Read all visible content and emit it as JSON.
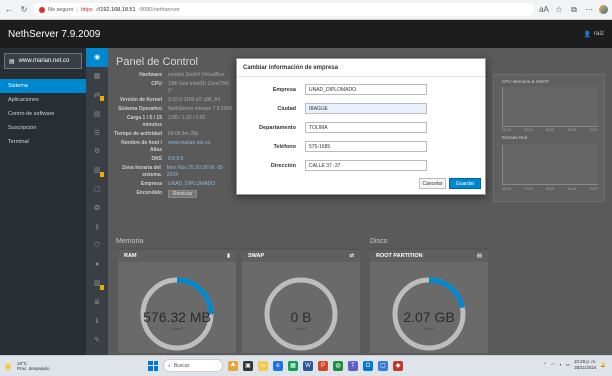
{
  "browser": {
    "insecure_label": "No seguro",
    "url_https": "https",
    "url_host": "://192.168.18.51",
    "url_path": ":9090/nethserver",
    "zoom_badge": "aA"
  },
  "app": {
    "brand": "NethServer 7.9.2009",
    "user_label": "raíz"
  },
  "sidebar": {
    "host": "www.marian.net.co",
    "items": [
      {
        "label": "Sistema"
      },
      {
        "label": "Aplicaciones"
      },
      {
        "label": "Centro de software"
      },
      {
        "label": "Suscripción"
      },
      {
        "label": "Terminal"
      }
    ]
  },
  "panel": {
    "title": "Panel de Control",
    "rows": [
      {
        "label": "Hardware",
        "value": "innotek GmbH VirtualBox"
      },
      {
        "label": "CPU",
        "value": "13th Gen Intel(R) Core(TM) i7"
      },
      {
        "label": "Versión de Kernel",
        "value": "3.10.0-1160.el7.x86_64"
      },
      {
        "label": "Sistema Operativo",
        "value": "NethServer release 7.9.2009"
      },
      {
        "label": "Carga 1 / 5 / 15 minutos",
        "value": "2.80 / 1.62 / 0.82"
      },
      {
        "label": "Tiempo de actividad",
        "value": "0d 0h 5m 28s"
      },
      {
        "label": "Nombre de host / Alias",
        "value": "www.marian.net.co"
      },
      {
        "label": "DNS",
        "value": "8.8.8.8"
      },
      {
        "label": "Zona horaria del sistema",
        "value": "Mon Nov 25 20:28:06 -05 2024"
      },
      {
        "label": "Empresa",
        "value": "UNAD_DIPLOMADO"
      },
      {
        "label": "Encendido",
        "value": "Reiniciar"
      }
    ],
    "memory_chart_legend": "CPU  Memoria & SWAP",
    "red_chart_legend": "Entrada  Red",
    "chart_ticks": [
      "20:23",
      "20:24",
      "20:25",
      "20:26",
      "20:27"
    ]
  },
  "sections": {
    "memoria": "Memoria",
    "disco": "Disco"
  },
  "cards": [
    {
      "title": "RAM",
      "value": "576.32 MB",
      "sub": "Used",
      "fraction": 0.25
    },
    {
      "title": "SWAP",
      "value": "0 B",
      "sub": "Used",
      "fraction": 0.0
    },
    {
      "title": "ROOT PARTITION",
      "value": "2.07 GB",
      "sub": "Used",
      "fraction": 0.22
    }
  ],
  "modal": {
    "title": "Cambiar información de empresa",
    "fields": [
      {
        "label": "Empresa",
        "value": "UNAD_DIPLOMADO"
      },
      {
        "label": "Ciudad",
        "value": "IBAGUÉ"
      },
      {
        "label": "Departamento",
        "value": "TOLIMA"
      },
      {
        "label": "Teléfono",
        "value": "575-1685"
      },
      {
        "label": "Dirección",
        "value": "CALLE 37 -37"
      }
    ],
    "cancel_label": "Cancelar",
    "save_label": "Guardar"
  },
  "taskbar": {
    "temp": "19°C",
    "weather": "Prac. despejado",
    "search_placeholder": "Buscar",
    "time": "10:28 p. m.",
    "date": "25/11/2024"
  },
  "colors": {
    "accent": "#0088ce",
    "sidebar": "#292e34",
    "badge": "#f0ab00"
  }
}
